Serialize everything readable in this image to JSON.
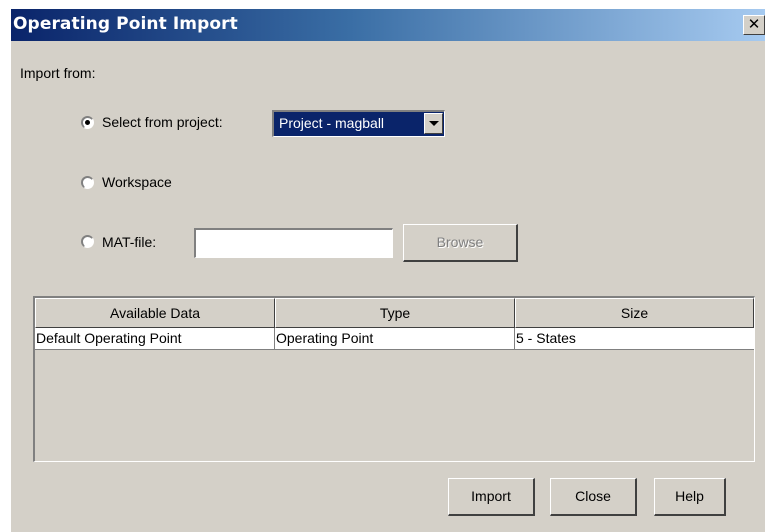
{
  "window": {
    "title": "Operating Point Import",
    "close_glyph": "✕"
  },
  "import_from": {
    "label": "Import from:",
    "options": [
      {
        "label": "Select from project:",
        "selected": true
      },
      {
        "label": "Workspace",
        "selected": false
      },
      {
        "label": "MAT-file:",
        "selected": false
      }
    ],
    "project_select": {
      "value": "Project - magball"
    },
    "mat_file": {
      "value": "",
      "browse_label": "Browse"
    }
  },
  "table": {
    "columns": [
      "Available Data",
      "Type",
      "Size"
    ],
    "rows": [
      [
        "Default Operating Point",
        "Operating Point",
        "5 - States"
      ]
    ]
  },
  "buttons": {
    "import": "Import",
    "close": "Close",
    "help": "Help"
  }
}
